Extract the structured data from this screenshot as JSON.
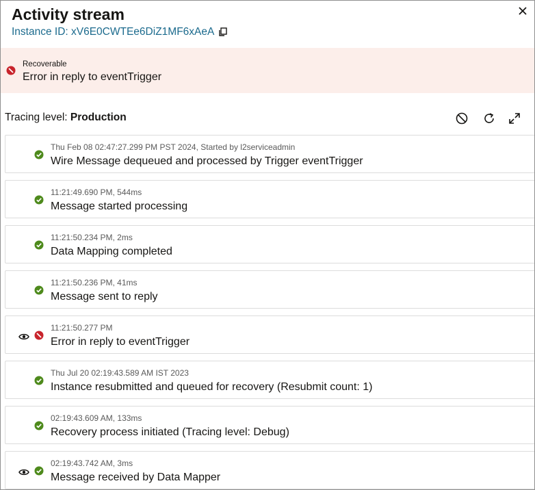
{
  "header": {
    "title": "Activity stream",
    "instance_id": "Instance ID: xV6E0CWTEe6DiZ1MF6xAeA"
  },
  "banner": {
    "status": "Recoverable",
    "message": "Error in reply to eventTrigger"
  },
  "tracing": {
    "label": "Tracing level:",
    "value": "Production"
  },
  "colors": {
    "success": "#4e8a1c",
    "error": "#c8242c",
    "link": "#1b6a8d",
    "banner_bg": "#fceeea"
  },
  "events": [
    {
      "meta": "Thu Feb 08 02:47:27.299 PM PST 2024, Started by l2serviceadmin",
      "message": "Wire Message dequeued and processed by Trigger eventTrigger",
      "status": "success",
      "has_eye": false
    },
    {
      "meta": "11:21:49.690 PM, 544ms",
      "message": "Message started processing",
      "status": "success",
      "has_eye": false
    },
    {
      "meta": "11:21:50.234 PM, 2ms",
      "message": "Data Mapping completed",
      "status": "success",
      "has_eye": false
    },
    {
      "meta": "11:21:50.236 PM, 41ms",
      "message": "Message sent to reply",
      "status": "success",
      "has_eye": false
    },
    {
      "meta": "11:21:50.277 PM",
      "message": "Error in reply to eventTrigger",
      "status": "error",
      "has_eye": true
    },
    {
      "meta": "Thu Jul 20 02:19:43.589 AM IST 2023",
      "message": "Instance resubmitted and queued for recovery (Resubmit count: 1)",
      "status": "success",
      "has_eye": false
    },
    {
      "meta": "02:19:43.609 AM, 133ms",
      "message": "Recovery process initiated (Tracing level: Debug)",
      "status": "success",
      "has_eye": false
    },
    {
      "meta": "02:19:43.742 AM, 3ms",
      "message": "Message received by Data Mapper",
      "status": "success",
      "has_eye": true
    }
  ]
}
